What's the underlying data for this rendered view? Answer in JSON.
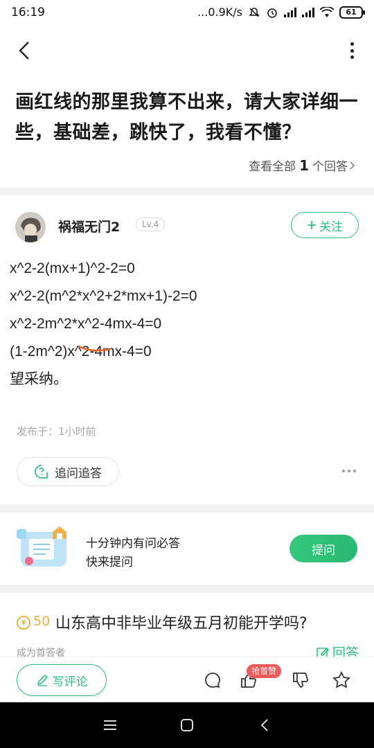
{
  "status_bar": {
    "time": "16:19",
    "network_speed": "...0.9K/s",
    "battery": "61",
    "icons": [
      "mute-icon",
      "alarm-icon",
      "signal-icon",
      "signal-icon",
      "wifi-icon",
      "battery-icon"
    ]
  },
  "header": {
    "back_icon": "back-arrow-icon",
    "more_icon": "more-vertical-icon",
    "question_title": "画红线的那里我算不出来，请大家详细一些，基础差，跳快了，我看不懂？",
    "view_all_prefix": "查看全部",
    "answer_count": "1",
    "view_all_suffix": "个回答"
  },
  "answer": {
    "user_name": "祸福无门2",
    "level": "Lv.4",
    "follow_label": "关注",
    "lines": [
      "x^2-2(mx+1)^2-2=0",
      "x^2-2(m^2*x^2+2*mx+1)-2=0",
      "x^2-2m^2*x^2-4mx-4=0",
      "(1-2m^2)x^2-4mx-4=0",
      "望采纳。"
    ],
    "published": "发布于：1小时前",
    "followup_label": "追问追答",
    "accent_color": "#2ec27e",
    "underline_color": "#e8651f"
  },
  "promo": {
    "line1": "十分钟内有问必答",
    "line2": "快来提问",
    "ask_label": "提问"
  },
  "recommend": {
    "reward": "50",
    "title": "山东高中非毕业年级五月初能开学吗?",
    "first_answer": "成为首答者",
    "answer_label": "回答",
    "reward_color": "#f0b43b"
  },
  "bottom_bar": {
    "comment_label": "写评论",
    "like_badge": "抢首赞"
  }
}
